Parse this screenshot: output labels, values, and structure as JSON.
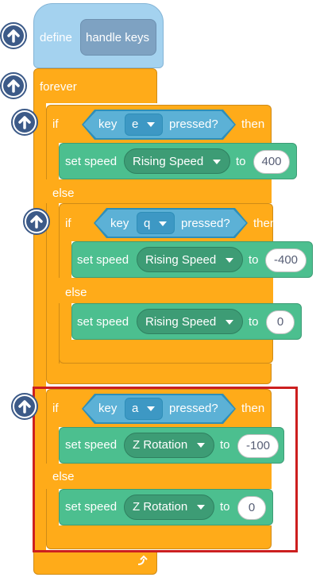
{
  "define_block": {
    "keyword": "define",
    "name": "handle keys"
  },
  "forever_block": {
    "label": "forever"
  },
  "if_e": {
    "if_label": "if",
    "key_label": "key",
    "key_value": "e",
    "pressed_label": "pressed?",
    "then_label": "then",
    "then_action": {
      "label": "set speed",
      "target": "Rising Speed",
      "to_label": "to",
      "value": "400"
    },
    "else_label": "else"
  },
  "if_q": {
    "if_label": "if",
    "key_label": "key",
    "key_value": "q",
    "pressed_label": "pressed?",
    "then_label": "then",
    "then_action": {
      "label": "set speed",
      "target": "Rising Speed",
      "to_label": "to",
      "value": "-400"
    },
    "else_label": "else",
    "else_action": {
      "label": "set speed",
      "target": "Rising Speed",
      "to_label": "to",
      "value": "0"
    }
  },
  "if_a": {
    "if_label": "if",
    "key_label": "key",
    "key_value": "a",
    "pressed_label": "pressed?",
    "then_label": "then",
    "then_action": {
      "label": "set speed",
      "target": "Z Rotation",
      "to_label": "to",
      "value": "-100"
    },
    "else_label": "else",
    "else_action": {
      "label": "set speed",
      "target": "Z Rotation",
      "to_label": "to",
      "value": "0"
    }
  },
  "colors": {
    "control": "#ffab19",
    "motion_ext": "#4cbf8f",
    "sensing": "#5cb1d6",
    "define": "#a4d2ef",
    "highlight": "#cc1f1f",
    "collapse_button": "#3c5a88"
  },
  "icons": {
    "collapse": "up-arrow-circle-icon",
    "loop": "loop-arrow-icon",
    "dropdown": "dropdown-caret-icon"
  }
}
